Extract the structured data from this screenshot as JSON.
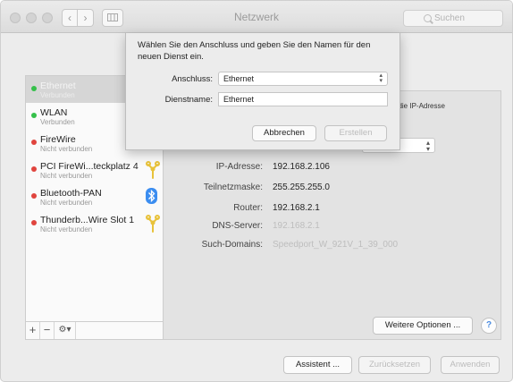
{
  "window": {
    "title": "Netzwerk",
    "search_placeholder": "Suchen",
    "nav_back_icon": "chevron-left-icon",
    "nav_forward_icon": "chevron-right-icon",
    "grid_icon": "show-all-grid-icon"
  },
  "colors": {
    "connected": "#35c04a",
    "disconnected": "#e0443e",
    "selected_row": "#d6d6d6"
  },
  "sidebar": {
    "services": [
      {
        "name": "Ethernet",
        "status": "Verbunden",
        "state": "connected",
        "selected": true,
        "icon": ""
      },
      {
        "name": "WLAN",
        "status": "Verbunden",
        "state": "connected",
        "selected": false,
        "icon": ""
      },
      {
        "name": "FireWire",
        "status": "Nicht verbunden",
        "state": "disconnected",
        "selected": false,
        "icon": ""
      },
      {
        "name": "PCI FireWi...teckplatz 4",
        "status": "Nicht verbunden",
        "state": "disconnected",
        "selected": false,
        "icon": "firewire-icon"
      },
      {
        "name": "Bluetooth-PAN",
        "status": "Nicht verbunden",
        "state": "disconnected",
        "selected": false,
        "icon": "bluetooth-icon"
      },
      {
        "name": "Thunderb...Wire Slot 1",
        "status": "Nicht verbunden",
        "state": "disconnected",
        "selected": false,
        "icon": "firewire-icon"
      }
    ],
    "toolbar": {
      "add_label": "+",
      "remove_label": "−",
      "gear_label": "⚙▾"
    }
  },
  "panel": {
    "ip_hint": "t die IP-Adresse",
    "rows": [
      {
        "label": "IP-Adresse:",
        "value": "192.168.2.106",
        "dim": false
      },
      {
        "label": "Teilnetzmaske:",
        "value": "255.255.255.0",
        "dim": false
      },
      {
        "label": "Router:",
        "value": "192.168.2.1",
        "dim": false
      },
      {
        "label": "DNS-Server:",
        "value": "192.168.2.1",
        "dim": true
      },
      {
        "label": "Such-Domains:",
        "value": "Speedport_W_921V_1_39_000",
        "dim": true
      }
    ],
    "more_options_label": "Weitere Optionen ...",
    "help_label": "?"
  },
  "footer": {
    "assistant_label": "Assistent ...",
    "revert_label": "Zurücksetzen",
    "apply_label": "Anwenden"
  },
  "sheet": {
    "message": "Wählen Sie den Anschluss und geben Sie den Namen für den neuen Dienst ein.",
    "interface_label": "Anschluss:",
    "interface_value": "Ethernet",
    "service_name_label": "Dienstname:",
    "service_name_value": "Ethernet",
    "cancel_label": "Abbrechen",
    "create_label": "Erstellen"
  }
}
